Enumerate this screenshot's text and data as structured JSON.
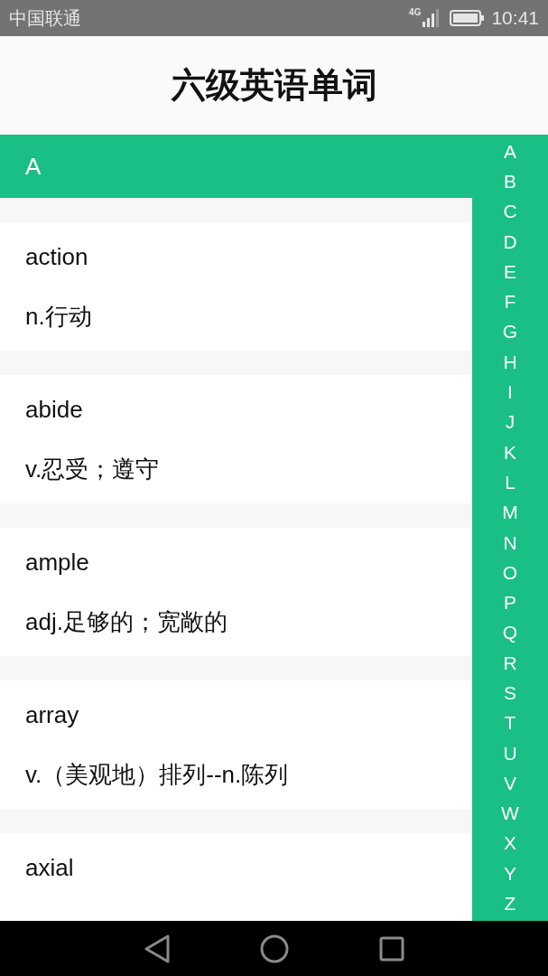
{
  "status_bar": {
    "carrier": "中国联通",
    "network": "4G",
    "time": "10:41"
  },
  "header": {
    "title": "六级英语单词"
  },
  "section": {
    "letter": "A"
  },
  "words": [
    {
      "word": "action",
      "meaning": "n.行动"
    },
    {
      "word": "abide",
      "meaning": "v.忍受；遵守"
    },
    {
      "word": "ample",
      "meaning": "adj.足够的；宽敞的"
    },
    {
      "word": "array",
      "meaning": "v.（美观地）排列--n.陈列"
    },
    {
      "word": "axial"
    }
  ],
  "index": [
    "A",
    "B",
    "C",
    "D",
    "E",
    "F",
    "G",
    "H",
    "I",
    "J",
    "K",
    "L",
    "M",
    "N",
    "O",
    "P",
    "Q",
    "R",
    "S",
    "T",
    "U",
    "V",
    "W",
    "X",
    "Y",
    "Z"
  ]
}
